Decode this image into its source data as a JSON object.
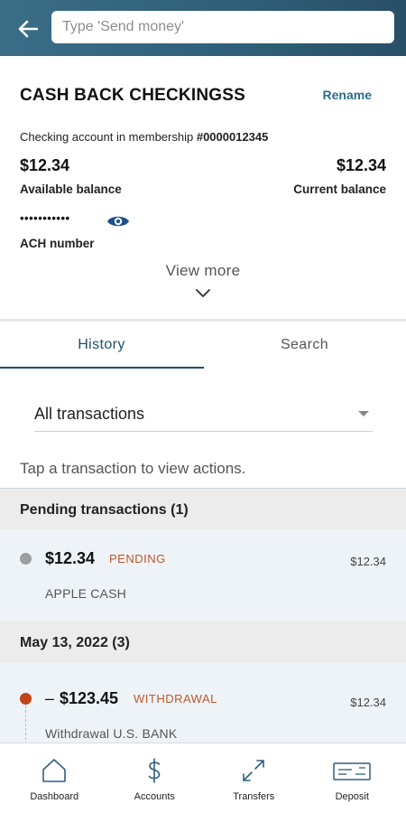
{
  "header": {
    "search_placeholder": "Type 'Send money'"
  },
  "account": {
    "name": "CASH BACK CHECKINGSS",
    "rename_label": "Rename",
    "membership_prefix": "Checking account in membership",
    "membership_number": "#0000012345",
    "available_balance": "$12.34",
    "available_label": "Available balance",
    "current_balance": "$12.34",
    "current_label": "Current balance",
    "ach_mask": "•••••••••••",
    "ach_label": "ACH number",
    "view_more": "View more"
  },
  "tabs": {
    "history": "History",
    "search": "Search"
  },
  "filter": {
    "selected": "All transactions"
  },
  "hint": "Tap a transaction to view actions.",
  "sections": [
    {
      "title": "Pending transactions (1)",
      "transactions": [
        {
          "sign": "",
          "amount": "$12.34",
          "badge": "PENDING",
          "right": "$12.34",
          "description": "APPLE CASH",
          "dot_color": "#9e9e9e"
        }
      ]
    },
    {
      "title": "May 13, 2022 (3)",
      "transactions": [
        {
          "sign": "–",
          "amount": "$123.45",
          "badge": "WITHDRAWAL",
          "right": "$12.34",
          "description": "Withdrawal U.S. BANK",
          "dot_color": "#c0451a"
        }
      ]
    }
  ],
  "bottom_nav": [
    {
      "label": "Dashboard",
      "icon": "home-icon"
    },
    {
      "label": "Accounts",
      "icon": "dollar-icon"
    },
    {
      "label": "Transfers",
      "icon": "transfer-arrows-icon"
    },
    {
      "label": "Deposit",
      "icon": "check-deposit-icon"
    }
  ],
  "colors": {
    "header_bg": "#2f5f78",
    "accent": "#1f4f6a",
    "badge": "#c0562b",
    "active_nav": "#6fd0e3"
  }
}
